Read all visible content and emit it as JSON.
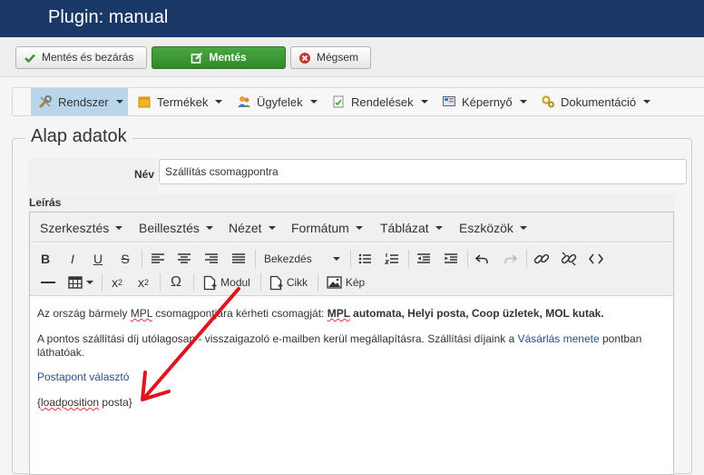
{
  "header": {
    "title": "Plugin: manual"
  },
  "actions": {
    "save_close": "Mentés és bezárás",
    "save": "Mentés",
    "cancel": "Mégsem"
  },
  "menu": {
    "items": [
      {
        "label": "Rendszer",
        "icon": "tools-icon"
      },
      {
        "label": "Termékek",
        "icon": "box-icon"
      },
      {
        "label": "Ügyfelek",
        "icon": "users-icon"
      },
      {
        "label": "Rendelések",
        "icon": "orders-icon"
      },
      {
        "label": "Képernyő",
        "icon": "screen-icon"
      },
      {
        "label": "Dokumentáció",
        "icon": "gears-icon"
      }
    ]
  },
  "form": {
    "legend": "Alap adatok",
    "name_label": "Név",
    "name_value": "Szállítás csomagpontra",
    "description_label": "Leírás"
  },
  "editor": {
    "menus": [
      "Szerkesztés",
      "Beillesztés",
      "Nézet",
      "Formátum",
      "Táblázat",
      "Eszközök"
    ],
    "toolbar": {
      "bold": "B",
      "italic": "I",
      "underline": "U",
      "strike": "S",
      "format_select": "Bekezdés",
      "subscript_base": "x",
      "subscript_mark": "2",
      "superscript_base": "x",
      "superscript_mark": "2",
      "omega": "Ω",
      "module": "Modul",
      "article": "Cikk",
      "image": "Kép"
    },
    "content": {
      "p1_a": "Az ország bármely ",
      "p1_mpl": "MPL",
      "p1_b": " csomagpontjára kérheti csomagját: ",
      "p1_strong_mpl": "MPL",
      "p1_strong_rest": " automata, Helyi posta, Coop üzletek, MOL kutak.",
      "p2_a": "A pontos szállítási díj utólagosan - visszaigazoló e-mailben kerül megállapításra. Szállítási díjaink a ",
      "p2_link": "Vásárlás menete",
      "p2_b": " pontban láthatóak.",
      "p3_link": "Postapont választó",
      "p4_open": "{",
      "p4_load": "loadposition",
      "p4_rest": " posta}"
    }
  },
  "colors": {
    "header_bg": "#1a3867",
    "primary_button": "#3a9b32",
    "link": "#2b4f86",
    "arrow": "#e0141e",
    "active_menu": "#b9d5ea"
  }
}
